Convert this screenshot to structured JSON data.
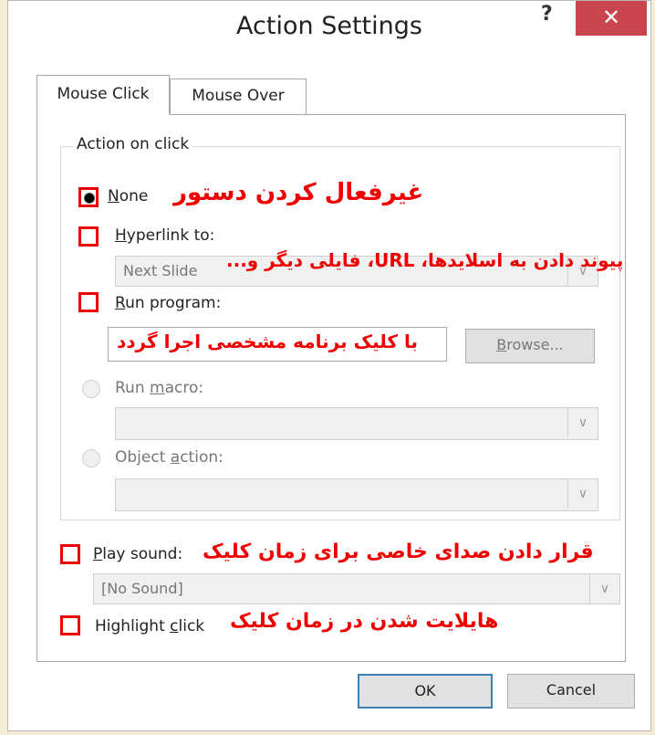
{
  "dialog": {
    "title": "Action Settings",
    "help_symbol": "?",
    "close_symbol": "✕"
  },
  "tabs": [
    {
      "label": "Mouse Click"
    },
    {
      "label": "Mouse Over"
    }
  ],
  "action_group": {
    "label": "Action on click",
    "none": {
      "label_u": "N",
      "label_rest": "one",
      "selected": true
    },
    "hyperlink": {
      "label_u": "H",
      "label_rest": "yperlink to:",
      "value": "Next Slide"
    },
    "run_program": {
      "label_u": "R",
      "label_rest": "un program:",
      "browse_label_u": "B",
      "browse_label_rest": "rowse..."
    },
    "run_macro": {
      "label_pre": "Run ",
      "label_u": "m",
      "label_rest": "acro:"
    },
    "object_action": {
      "label_pre": "Object ",
      "label_u": "a",
      "label_rest": "ction:"
    }
  },
  "play_sound": {
    "label_u": "P",
    "label_rest": "lay sound:",
    "value": "[No Sound]"
  },
  "highlight": {
    "label_pre": "Highlight ",
    "label_u": "c",
    "label_rest": "lick"
  },
  "buttons": {
    "ok": "OK",
    "cancel": "Cancel"
  },
  "annotations": {
    "none": "غیرفعال کردن دستور",
    "hyperlink": "پیوند دادن به اسلایدها، URL، فایلی دیگر و...",
    "run_program": "با کلیک برنامه مشخصی اجرا گردد",
    "play_sound": "قرار دادن صدای خاصی برای زمان کلیک",
    "highlight": "هایلایت شدن در زمان کلیک"
  },
  "colors": {
    "annotation": "#ee0000",
    "close_button": "#c9464f",
    "ok_border": "#3c7fb1"
  }
}
